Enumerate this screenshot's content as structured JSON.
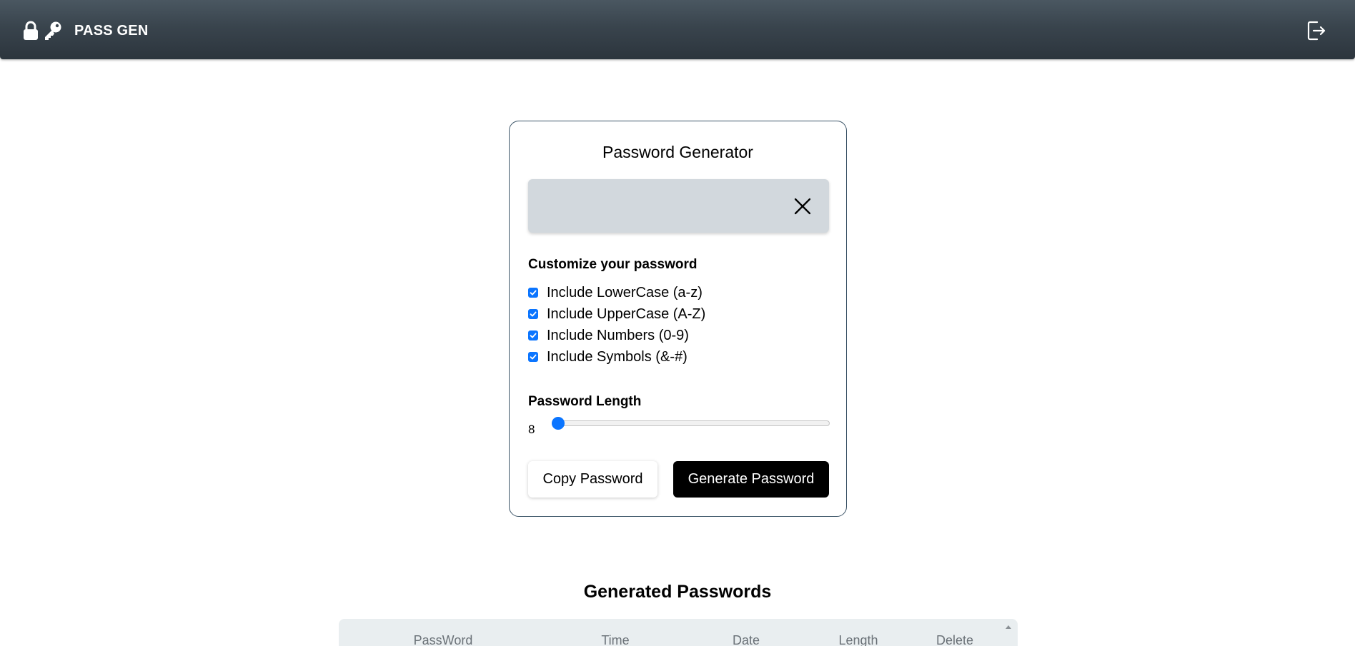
{
  "navbar": {
    "brand": "PASS GEN",
    "icons": [
      "lock-icon",
      "key-icon",
      "logout-icon"
    ],
    "background": "#2f3940"
  },
  "generator": {
    "title": "Password Generator",
    "password_value": "",
    "clear_icon": "close-icon",
    "customize_heading": "Customize your password",
    "options": [
      {
        "label": "Include LowerCase (a-z)",
        "checked": true
      },
      {
        "label": "Include UpperCase (A-Z)",
        "checked": true
      },
      {
        "label": "Include Numbers (0-9)",
        "checked": true
      },
      {
        "label": "Include Symbols (&-#)",
        "checked": true
      }
    ],
    "length_heading": "Password Length",
    "length_value": "8",
    "length_fraction": 0.0,
    "copy_label": "Copy Password",
    "generate_label": "Generate Password",
    "accent_color": "#0b75ff"
  },
  "history": {
    "title": "Generated Passwords",
    "columns": [
      "PassWord",
      "Time",
      "Date",
      "Length",
      "Delete"
    ]
  }
}
